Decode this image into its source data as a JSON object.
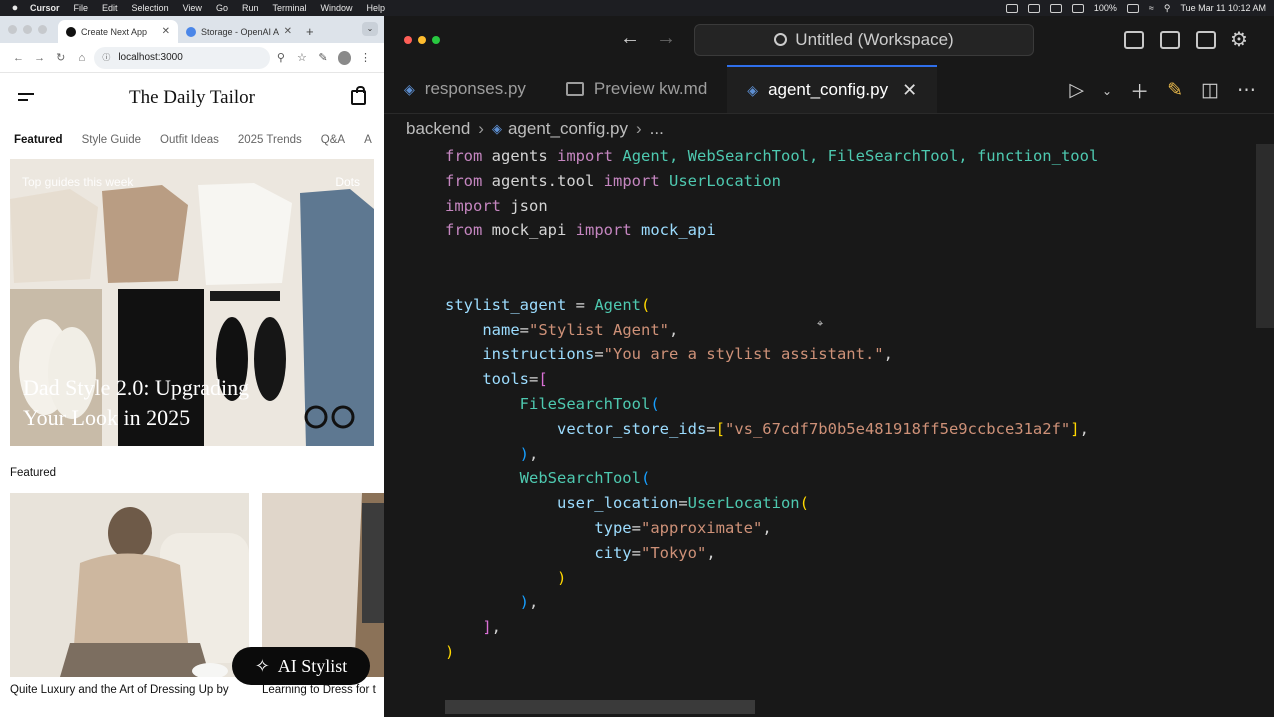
{
  "menubar": {
    "app": "Cursor",
    "items": [
      "File",
      "Edit",
      "Selection",
      "View",
      "Go",
      "Run",
      "Terminal",
      "Window",
      "Help"
    ],
    "battery": "100%",
    "datetime": "Tue Mar 11  10:12 AM"
  },
  "browser": {
    "tabs": [
      {
        "label": "Create Next App",
        "active": true
      },
      {
        "label": "Storage - OpenAI A",
        "active": false
      }
    ],
    "new_tab": "+",
    "url": "localhost:3000"
  },
  "site": {
    "title": "The Daily Tailor",
    "nav": [
      "Featured",
      "Style Guide",
      "Outfit Ideas",
      "2025 Trends",
      "Q&A",
      "A"
    ],
    "hero": {
      "tag_left": "Top guides this week",
      "tag_right": "Dots",
      "headline": "Dad Style 2.0: Upgrading Your Look in 2025"
    },
    "featured_label": "Featured",
    "cards": [
      {
        "caption": "Quite Luxury and the Art of Dressing Up by"
      },
      {
        "caption": "Learning to Dress for t"
      }
    ],
    "ai_button": "AI Stylist"
  },
  "editor": {
    "workspace_title": "Untitled (Workspace)",
    "tabs": [
      {
        "label": "responses.py",
        "type": "py",
        "active": false
      },
      {
        "label": "Preview kw.md",
        "type": "md",
        "active": false
      },
      {
        "label": "agent_config.py",
        "type": "py",
        "active": true
      }
    ],
    "breadcrumbs": {
      "folder": "backend",
      "file": "agent_config.py",
      "more": "..."
    },
    "code": {
      "import1_from": "from",
      "import1_mod": "agents",
      "import1_kw": "import",
      "import1_names": "Agent, WebSearchTool, FileSearchTool, function_tool",
      "import2_from": "from",
      "import2_mod": "agents.tool",
      "import2_kw": "import",
      "import2_name": "UserLocation",
      "import3_kw": "import",
      "import3_mod": "json",
      "import4_from": "from",
      "import4_mod": "mock_api",
      "import4_kw": "import",
      "import4_name": "mock_api",
      "var": "stylist_agent",
      "cls": "Agent",
      "name_key": "name",
      "name_val": "\"Stylist Agent\"",
      "instr_key": "instructions",
      "instr_val": "\"You are a stylist assistant.\"",
      "tools_key": "tools",
      "fst": "FileSearchTool",
      "vs_key": "vector_store_ids",
      "vs_val": "\"vs_67cdf7b0b5e481918ff5e9ccbce31a2f\"",
      "wst": "WebSearchTool",
      "ul_key": "user_location",
      "ul_cls": "UserLocation",
      "type_key": "type",
      "type_val": "\"approximate\"",
      "city_key": "city",
      "city_val": "\"Tokyo\""
    }
  }
}
